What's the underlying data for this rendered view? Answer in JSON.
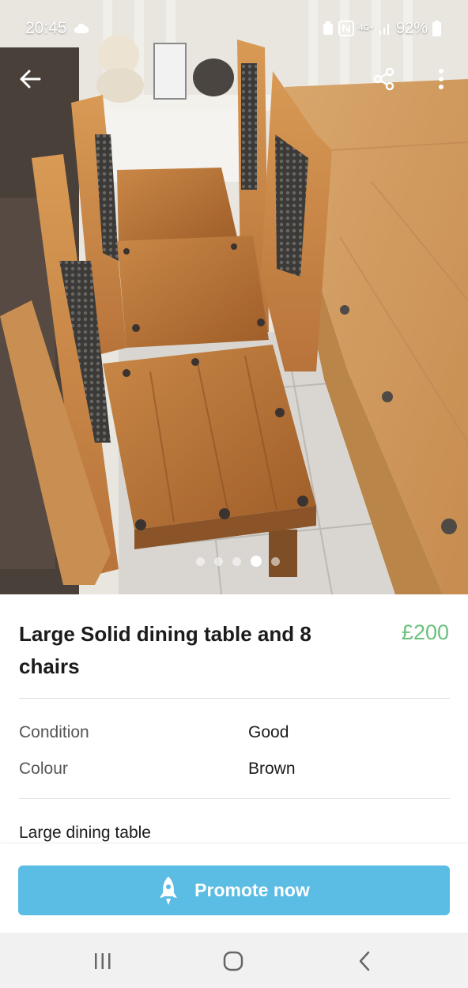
{
  "status_bar": {
    "time": "20:45",
    "network": "4G+",
    "battery": "92%",
    "icons": [
      "cloud-icon",
      "battery-saver-icon",
      "nfc-icon",
      "network-4g-icon",
      "signal-icon",
      "battery-icon"
    ]
  },
  "app_bar": {
    "icons": [
      "back-arrow-icon",
      "share-icon",
      "more-vertical-icon"
    ]
  },
  "gallery": {
    "image_count": 5,
    "active_index": 3
  },
  "listing": {
    "title": "Large Solid dining table and 8 chairs",
    "price": "£200",
    "attributes": [
      {
        "label": "Condition",
        "value": "Good"
      },
      {
        "label": "Colour",
        "value": "Brown"
      }
    ],
    "description": "Large dining table"
  },
  "promote": {
    "label": "Promote now",
    "icon": "rocket-icon"
  },
  "nav_bar": {
    "icons": [
      "recent-apps-icon",
      "home-icon",
      "nav-back-icon"
    ]
  },
  "colors": {
    "price": "#6cc07e",
    "promote_button": "#5bbce4",
    "nav_background": "#f1f1f1"
  }
}
